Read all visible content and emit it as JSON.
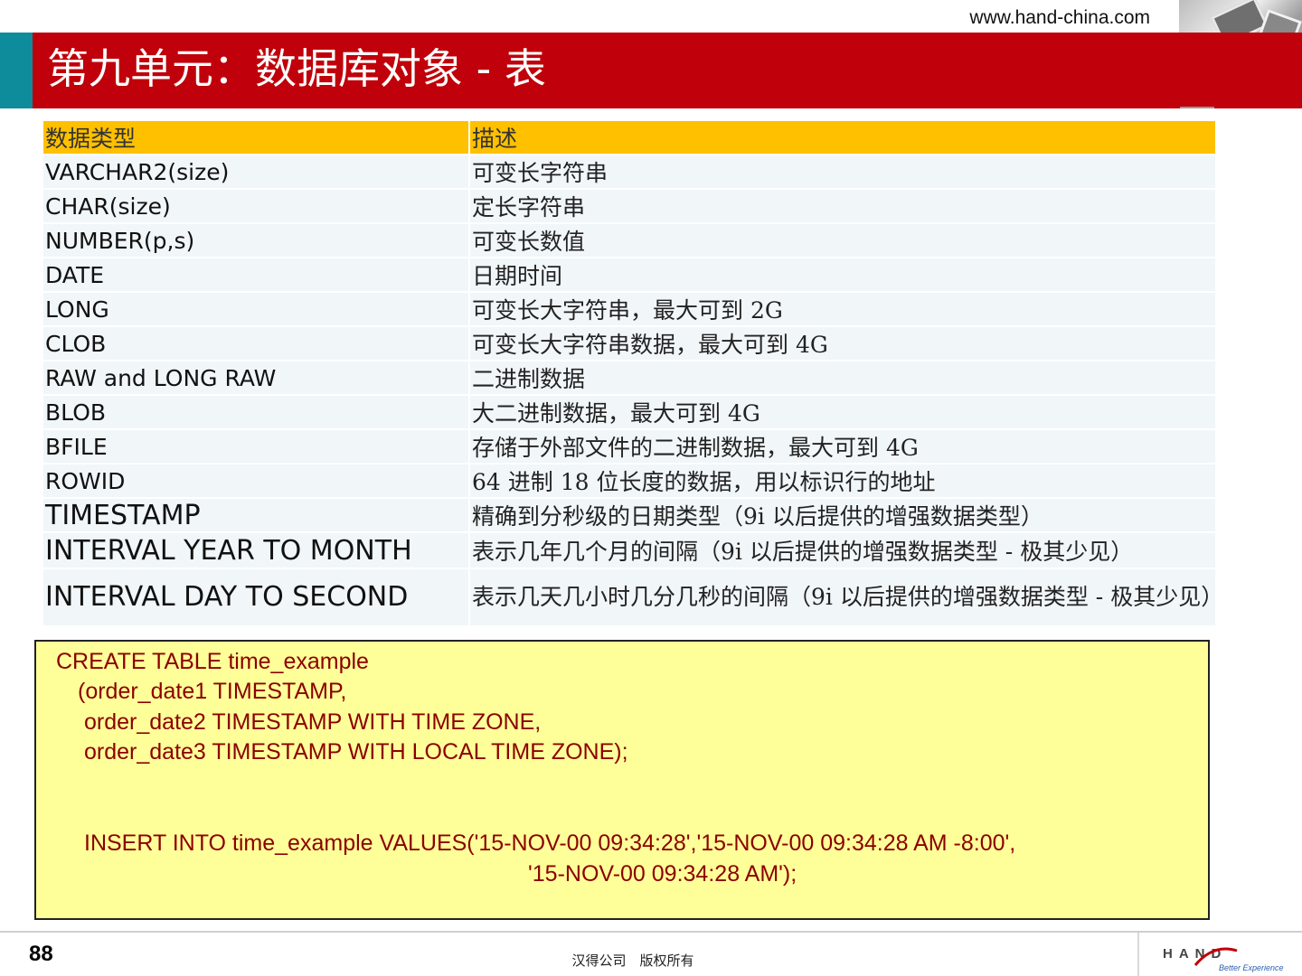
{
  "header": {
    "url": "www.hand-china.com",
    "title": "第九单元：数据库对象 - 表"
  },
  "colors": {
    "title_bar": "#c0000a",
    "accent": "#0e8c9c",
    "table_header": "#ffc000",
    "code_background": "#ffff99",
    "code_text": "#8b0000"
  },
  "table": {
    "headers": [
      "数据类型",
      "描述"
    ],
    "rows": [
      {
        "type": "VARCHAR2(size)",
        "desc": "可变长字符串"
      },
      {
        "type": "CHAR(size)",
        "desc": "定长字符串"
      },
      {
        "type": "NUMBER(p,s)",
        "desc": "可变长数值"
      },
      {
        "type": "DATE",
        "desc": "日期时间"
      },
      {
        "type": "LONG",
        "desc": "可变长大字符串，最大可到 2G"
      },
      {
        "type": "CLOB",
        "desc": "可变长大字符串数据，最大可到 4G"
      },
      {
        "type": "RAW and LONG RAW",
        "desc": "二进制数据"
      },
      {
        "type": "BLOB",
        "desc": "大二进制数据，最大可到 4G"
      },
      {
        "type": "BFILE",
        "desc": "存储于外部文件的二进制数据，最大可到 4G"
      },
      {
        "type": "ROWID",
        "desc": "64 进制 18 位长度的数据，用以标识行的地址"
      },
      {
        "type": "TIMESTAMP",
        "desc": "精确到分秒级的日期类型（9i 以后提供的增强数据类型）"
      },
      {
        "type": "INTERVAL YEAR TO MONTH",
        "desc": "表示几年几个月的间隔（9i 以后提供的增强数据类型 - 极其少见）"
      },
      {
        "type": "INTERVAL DAY TO SECOND",
        "desc": "表示几天几小时几分几秒的间隔（9i 以后提供的增强数据类型 - 极其少见）"
      }
    ]
  },
  "code": {
    "lines": [
      "CREATE TABLE time_example",
      "(order_date1 TIMESTAMP,",
      "order_date2 TIMESTAMP WITH TIME ZONE,",
      "order_date3 TIMESTAMP WITH LOCAL TIME ZONE);",
      "INSERT INTO time_example VALUES('15-NOV-00 09:34:28','15-NOV-00 09:34:28 AM -8:00',",
      "'15-NOV-00 09:34:28 AM');"
    ]
  },
  "footer": {
    "page_number": "88",
    "copyright": "汉得公司　版权所有",
    "logo_text": "HAND",
    "logo_tagline": "Better Experience"
  }
}
